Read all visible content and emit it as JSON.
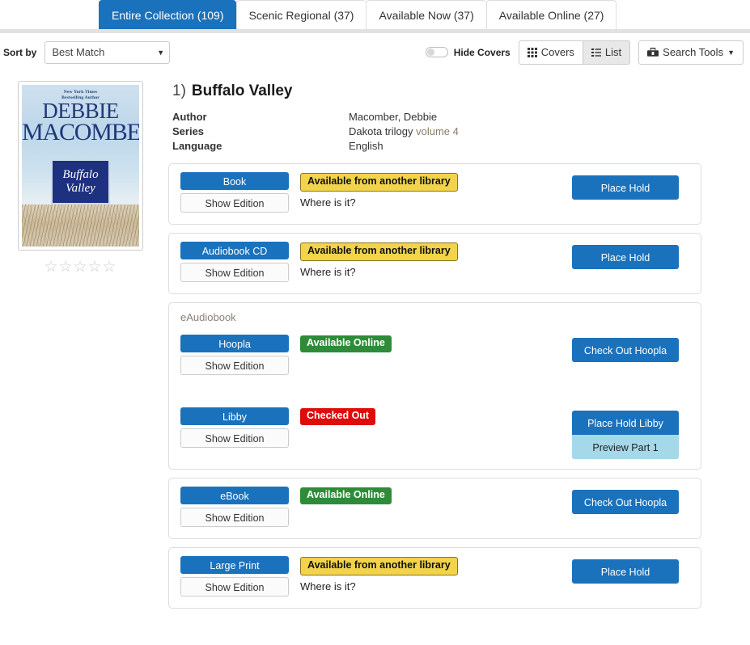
{
  "tabs": [
    {
      "label": "Entire Collection (109)",
      "active": true
    },
    {
      "label": "Scenic Regional (37)",
      "active": false
    },
    {
      "label": "Available Now (37)",
      "active": false
    },
    {
      "label": "Available Online (27)",
      "active": false
    }
  ],
  "toolbar": {
    "sort_label": "Sort by",
    "sort_value": "Best Match",
    "sort_options": [
      "Best Match"
    ],
    "hide_covers_label": "Hide Covers",
    "hide_covers_on": false,
    "covers_label": "Covers",
    "list_label": "List",
    "search_tools_label": "Search Tools"
  },
  "result": {
    "rank": "1)",
    "title": "Buffalo Valley",
    "cover": {
      "byline": "New York Times\nBestselling Author",
      "author_line1": "DEBBIE",
      "author_line2": "MACOMBER",
      "title_line1": "Buffalo",
      "title_line2": "Valley"
    },
    "rating_stars": "☆☆☆☆☆",
    "metadata": [
      {
        "key": "Author",
        "value": "Macomber, Debbie",
        "volume": "",
        "muted": false
      },
      {
        "key": "Series",
        "value": "Dakota trilogy",
        "volume": "volume 4",
        "muted": false
      },
      {
        "key": "Language",
        "value": "English",
        "volume": "",
        "muted": true
      }
    ],
    "show_edition_label": "Show Edition",
    "formats": [
      {
        "group": "",
        "rows": [
          {
            "format": "Book",
            "status": "Available from another library",
            "status_type": "yellow",
            "where": "Where is it?",
            "actions": [
              {
                "label": "Place Hold",
                "style": "primary"
              }
            ]
          }
        ]
      },
      {
        "group": "",
        "rows": [
          {
            "format": "Audiobook CD",
            "status": "Available from another library",
            "status_type": "yellow",
            "where": "Where is it?",
            "actions": [
              {
                "label": "Place Hold",
                "style": "primary"
              }
            ]
          }
        ]
      },
      {
        "group": "eAudiobook",
        "rows": [
          {
            "format": "Hoopla",
            "status": "Available Online",
            "status_type": "green",
            "where": "",
            "actions": [
              {
                "label": "Check Out Hoopla",
                "style": "primary"
              }
            ]
          },
          {
            "format": "Libby",
            "status": "Checked Out",
            "status_type": "red",
            "where": "",
            "actions": [
              {
                "label": "Place Hold Libby",
                "style": "primary-top"
              },
              {
                "label": "Preview Part 1",
                "style": "secondary"
              }
            ]
          }
        ]
      },
      {
        "group": "",
        "rows": [
          {
            "format": "eBook",
            "status": "Available Online",
            "status_type": "green",
            "where": "",
            "actions": [
              {
                "label": "Check Out Hoopla",
                "style": "primary"
              }
            ]
          }
        ]
      },
      {
        "group": "",
        "rows": [
          {
            "format": "Large Print",
            "status": "Available from another library",
            "status_type": "yellow",
            "where": "Where is it?",
            "actions": [
              {
                "label": "Place Hold",
                "style": "primary"
              }
            ]
          }
        ]
      }
    ]
  },
  "colors": {
    "accent_blue": "#1b72bc",
    "badge_yellow": "#f2d44b",
    "badge_green": "#2e8b38",
    "badge_red": "#e00b0b",
    "secondary_blue": "#a5d8e8"
  }
}
